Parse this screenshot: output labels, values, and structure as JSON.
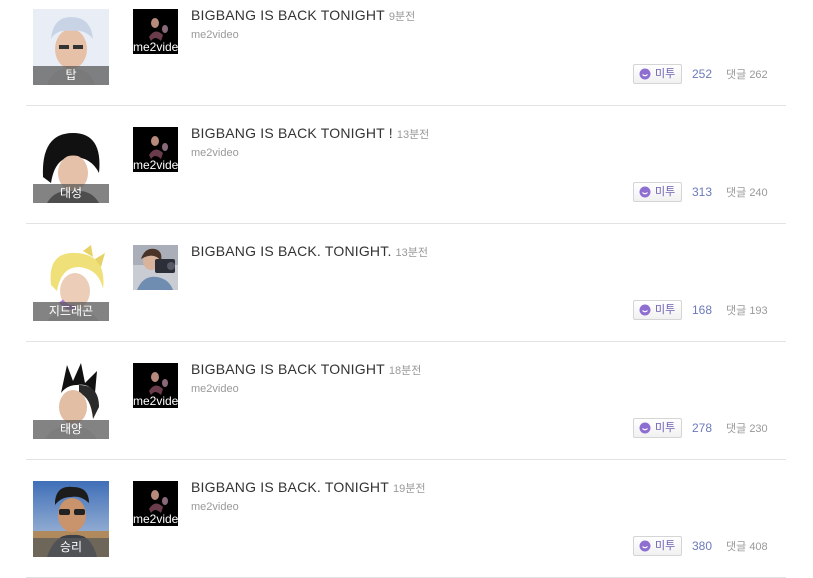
{
  "posts": [
    {
      "author": "탑",
      "avatar_icon": "profile-photo-top",
      "thumb_label": "me2vide",
      "title": "BIGBANG IS BACK TONIGHT",
      "time": "9분전",
      "source": "me2video",
      "metoo_label": "미투",
      "metoo_count": "252",
      "comment_label": "댓글",
      "comment_count": "262"
    },
    {
      "author": "대성",
      "avatar_icon": "profile-photo-daesung",
      "thumb_label": "me2vide",
      "title": "BIGBANG IS BACK TONIGHT !",
      "time": "13분전",
      "source": "me2video",
      "metoo_label": "미투",
      "metoo_count": "313",
      "comment_label": "댓글",
      "comment_count": "240"
    },
    {
      "author": "지드래곤",
      "avatar_icon": "profile-photo-gdragon",
      "thumb_label": "",
      "title": "BIGBANG IS BACK. TONIGHT.",
      "time": "13분전",
      "source": "",
      "metoo_label": "미투",
      "metoo_count": "168",
      "comment_label": "댓글",
      "comment_count": "193"
    },
    {
      "author": "태양",
      "avatar_icon": "profile-photo-taeyang",
      "thumb_label": "me2vide",
      "title": "BIGBANG IS BACK TONIGHT",
      "time": "18분전",
      "source": "me2video",
      "metoo_label": "미투",
      "metoo_count": "278",
      "comment_label": "댓글",
      "comment_count": "230"
    },
    {
      "author": "승리",
      "avatar_icon": "profile-photo-seungri",
      "thumb_label": "me2vide",
      "title": "BIGBANG IS BACK. TONIGHT",
      "time": "19분전",
      "source": "me2video",
      "metoo_label": "미투",
      "metoo_count": "380",
      "comment_label": "댓글",
      "comment_count": "408"
    }
  ],
  "colors": {
    "metoo_accent": "#8e6fd1",
    "count_text": "#6b7ab8"
  }
}
